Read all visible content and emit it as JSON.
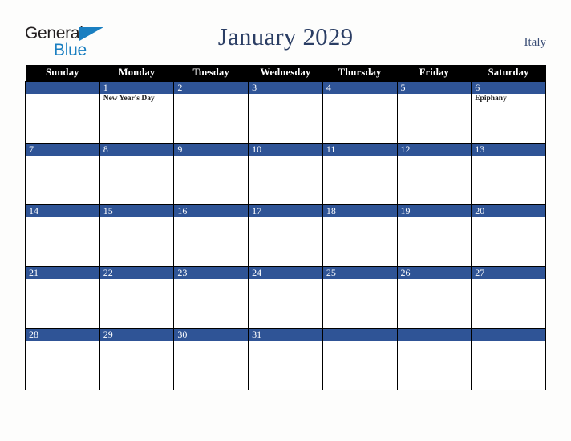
{
  "brand": {
    "name_part1": "General",
    "name_part2": "Blue",
    "triangle_icon": "blue-triangle-icon",
    "color_dark": "#231f20",
    "color_blue": "#1a7fc1"
  },
  "header": {
    "title": "January 2029",
    "locale": "Italy",
    "title_color": "#2b3e64"
  },
  "calendar": {
    "month": "January",
    "year": "2029",
    "accent_color": "#2f5496",
    "header_bg": "#000000",
    "weekday_headers": [
      "Sunday",
      "Monday",
      "Tuesday",
      "Wednesday",
      "Thursday",
      "Friday",
      "Saturday"
    ],
    "weeks": [
      [
        {
          "day": "",
          "events": []
        },
        {
          "day": "1",
          "events": [
            "New Year's Day"
          ]
        },
        {
          "day": "2",
          "events": []
        },
        {
          "day": "3",
          "events": []
        },
        {
          "day": "4",
          "events": []
        },
        {
          "day": "5",
          "events": []
        },
        {
          "day": "6",
          "events": [
            "Epiphany"
          ]
        }
      ],
      [
        {
          "day": "7",
          "events": []
        },
        {
          "day": "8",
          "events": []
        },
        {
          "day": "9",
          "events": []
        },
        {
          "day": "10",
          "events": []
        },
        {
          "day": "11",
          "events": []
        },
        {
          "day": "12",
          "events": []
        },
        {
          "day": "13",
          "events": []
        }
      ],
      [
        {
          "day": "14",
          "events": []
        },
        {
          "day": "15",
          "events": []
        },
        {
          "day": "16",
          "events": []
        },
        {
          "day": "17",
          "events": []
        },
        {
          "day": "18",
          "events": []
        },
        {
          "day": "19",
          "events": []
        },
        {
          "day": "20",
          "events": []
        }
      ],
      [
        {
          "day": "21",
          "events": []
        },
        {
          "day": "22",
          "events": []
        },
        {
          "day": "23",
          "events": []
        },
        {
          "day": "24",
          "events": []
        },
        {
          "day": "25",
          "events": []
        },
        {
          "day": "26",
          "events": []
        },
        {
          "day": "27",
          "events": []
        }
      ],
      [
        {
          "day": "28",
          "events": []
        },
        {
          "day": "29",
          "events": []
        },
        {
          "day": "30",
          "events": []
        },
        {
          "day": "31",
          "events": []
        },
        {
          "day": "",
          "events": []
        },
        {
          "day": "",
          "events": []
        },
        {
          "day": "",
          "events": []
        }
      ]
    ]
  }
}
